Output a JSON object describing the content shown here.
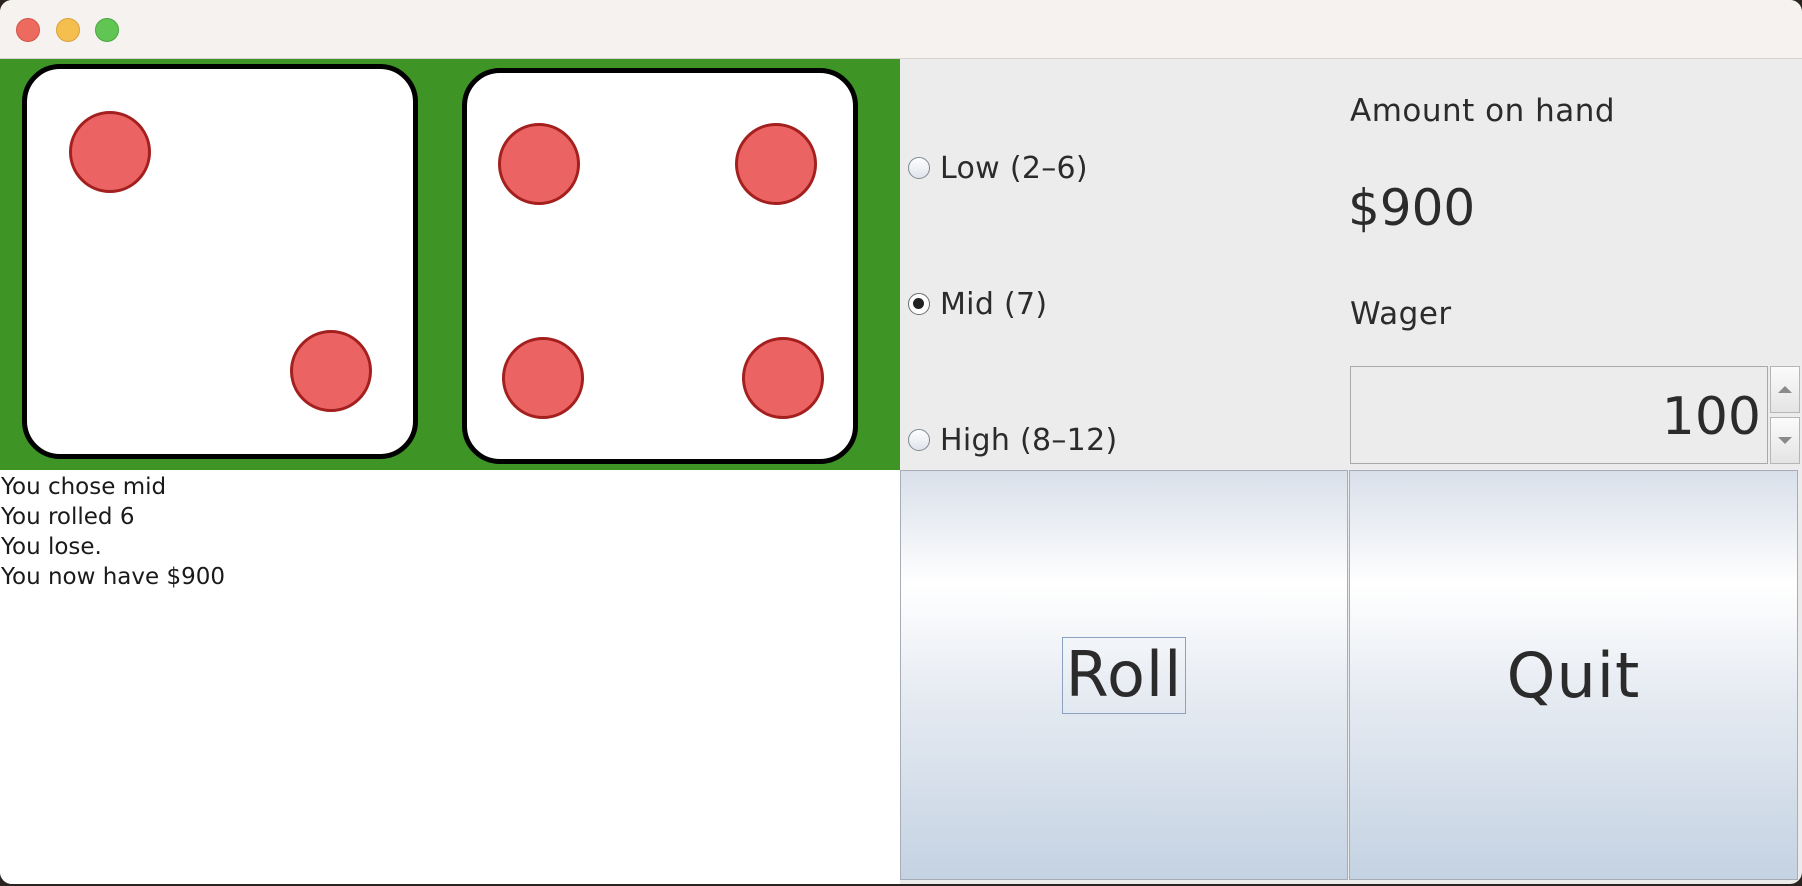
{
  "window": {
    "controls": [
      "close",
      "minimize",
      "maximize"
    ]
  },
  "dice": [
    {
      "value": 2
    },
    {
      "value": 4
    }
  ],
  "colors": {
    "table_felt": "#3f9426",
    "pip_fill": "#ec6363",
    "pip_border": "#a3201e"
  },
  "bets": {
    "options": [
      {
        "label": "Low (2–6)",
        "checked": false
      },
      {
        "label": "Mid (7)",
        "checked": true
      },
      {
        "label": "High (8–12)",
        "checked": false
      }
    ]
  },
  "bank": {
    "amount_label": "Amount on hand",
    "amount_value": "$900",
    "wager_label": "Wager",
    "wager_value": "100"
  },
  "log": {
    "lines": [
      "You chose mid",
      "You rolled 6",
      "You lose.",
      "You now have $900"
    ]
  },
  "buttons": {
    "roll_label": "Roll",
    "quit_label": "Quit"
  }
}
